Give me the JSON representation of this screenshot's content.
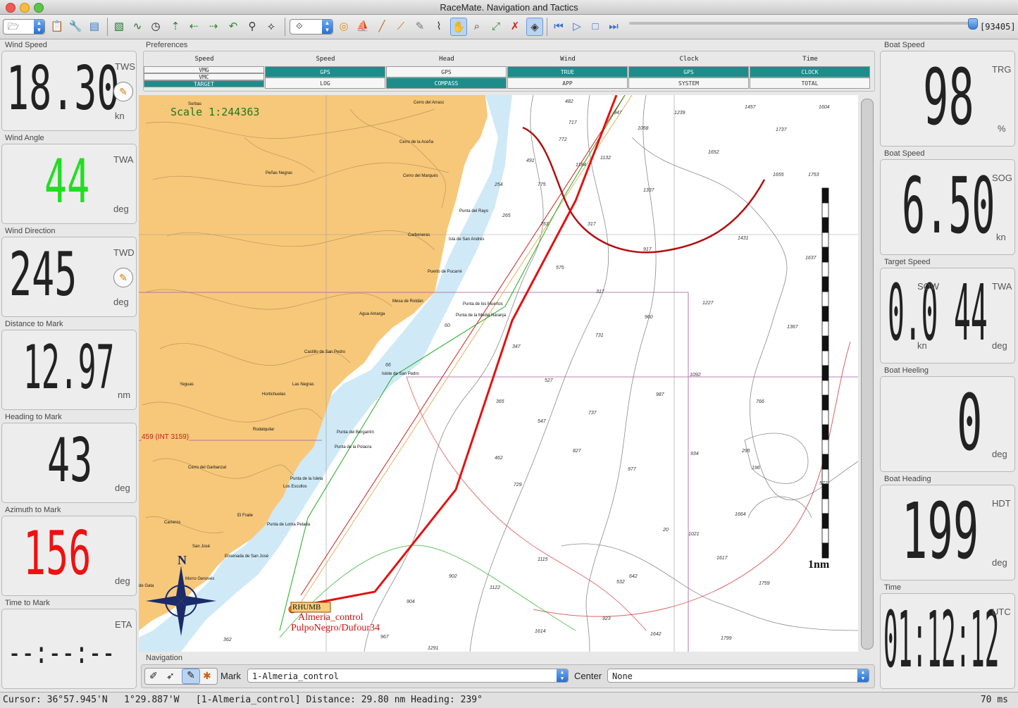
{
  "window": {
    "title": "RaceMate. Navigation and Tactics"
  },
  "toolbar": {
    "counter": "[93405]",
    "slider_position": 0.99,
    "icons": [
      "open-file-icon",
      "clipboard-icon",
      "wrench-icon",
      "database-icon",
      "chart-icon",
      "track-icon",
      "clock-icon",
      "waypoint-icon",
      "arrow-left-icon",
      "arrow-right-icon",
      "undo-icon",
      "route-icon",
      "route-edit-icon",
      "mode-select-icon",
      "target-icon",
      "boat-icon",
      "measure-icon",
      "ruler-icon",
      "pencil-icon",
      "draw-icon",
      "hand-icon",
      "zoom-icon",
      "fit-icon",
      "delete-icon",
      "layer-icon",
      "rewind-icon",
      "play-icon",
      "stop-icon",
      "fast-forward-icon"
    ]
  },
  "left": {
    "wind_speed": {
      "label": "Wind Speed",
      "value": "18.30",
      "tag": "TWS",
      "unit": "kn",
      "color": "#111111"
    },
    "wind_angle": {
      "label": "Wind Angle",
      "value": "44",
      "tag": "TWA",
      "unit": "deg",
      "color": "#22dd22"
    },
    "wind_dir": {
      "label": "Wind Direction",
      "value": "245",
      "tag": "TWD",
      "unit": "deg",
      "color": "#111111"
    },
    "dist_mark": {
      "label": "Distance to Mark",
      "value": "12.97",
      "unit": "nm",
      "color": "#111111"
    },
    "heading_mark": {
      "label": "Heading to Mark",
      "value": "43",
      "unit": "deg",
      "color": "#111111"
    },
    "azimuth_mark": {
      "label": "Azimuth to Mark",
      "value": "156",
      "unit": "deg",
      "color": "#ee1111"
    },
    "time_mark": {
      "label": "Time to Mark",
      "value": "--:--:--",
      "tag": "ETA",
      "color": "#111111"
    }
  },
  "right": {
    "boat_speed_trg": {
      "label": "Boat Speed",
      "value": "98",
      "tag": "TRG",
      "unit": "%"
    },
    "boat_speed_sog": {
      "label": "Boat Speed",
      "value": "6.50",
      "tag": "SOG",
      "unit": "kn"
    },
    "target_speed": {
      "label": "Target Speed",
      "sow_value": "0.0",
      "sow_tag": "SOW",
      "sow_unit": "kn",
      "twa_value": "44",
      "twa_tag": "TWA",
      "twa_unit": "deg"
    },
    "boat_heeling": {
      "label": "Boat Heeling",
      "value": "0",
      "unit": "deg"
    },
    "boat_heading": {
      "label": "Boat Heading",
      "value": "199",
      "tag": "HDT",
      "unit": "deg"
    },
    "time": {
      "label": "Time",
      "value": "01:12:12",
      "tag": "UTC"
    }
  },
  "preferences": {
    "label": "Preferences",
    "columns": [
      {
        "header": "Speed",
        "options": [
          {
            "text": "VMG",
            "on": false
          },
          {
            "text": "VMC",
            "on": false
          },
          {
            "text": "TARGET",
            "on": true
          }
        ]
      },
      {
        "header": "Speed",
        "options": [
          {
            "text": "GPS",
            "on": true
          },
          {
            "text": "LOG",
            "on": false
          }
        ]
      },
      {
        "header": "Head",
        "options": [
          {
            "text": "GPS",
            "on": false
          },
          {
            "text": "COMPASS",
            "on": true
          }
        ]
      },
      {
        "header": "Wind",
        "options": [
          {
            "text": "TRUE",
            "on": true
          },
          {
            "text": "APP",
            "on": false
          }
        ]
      },
      {
        "header": "Clock",
        "options": [
          {
            "text": "GPS",
            "on": true
          },
          {
            "text": "SYSTEM",
            "on": false
          }
        ]
      },
      {
        "header": "Time",
        "options": [
          {
            "text": "CLOCK",
            "on": true
          },
          {
            "text": "TOTAL",
            "on": false
          }
        ]
      }
    ]
  },
  "chart": {
    "scale": "Scale 1:244363",
    "scale_bar_label": "1nm",
    "mark_label": "Almeria_control",
    "boat_label": "PulpoNegro/Dufour34",
    "mark_tag": "RHUMB",
    "chart_ref": "459 (INT 3159)",
    "places": [
      {
        "t": "Sorbas"
      },
      {
        "t": "Cerro del Arrasc"
      },
      {
        "t": "Cerro de la Aceña"
      },
      {
        "t": "Cerro del Marqués"
      },
      {
        "t": "Peñas Negras"
      },
      {
        "t": "Punta del Rayo"
      },
      {
        "t": "Carboneras"
      },
      {
        "t": "Isla de San Andrés"
      },
      {
        "t": "Puerto de Pucarré"
      },
      {
        "t": "Mesa de Roldán"
      },
      {
        "t": "Agua Amarga"
      },
      {
        "t": "Punta de los Muertos"
      },
      {
        "t": "Punta de la Media Naranja"
      },
      {
        "t": "Castillo de San Pedro"
      },
      {
        "t": "Islote de San Pedro"
      },
      {
        "t": "Las Negras"
      },
      {
        "t": "Yeguas"
      },
      {
        "t": "Hortichuelas"
      },
      {
        "t": "Rodalquilar"
      },
      {
        "t": "Punta del Bergantín"
      },
      {
        "t": "Punta de la Polacra"
      },
      {
        "t": "Cerro del Garbanzal"
      },
      {
        "t": "Punta de la Isleta"
      },
      {
        "t": "Los Escullos"
      },
      {
        "t": "El Fraile"
      },
      {
        "t": "Punta de Loma Pelada"
      },
      {
        "t": "Carreros"
      },
      {
        "t": "San José"
      },
      {
        "t": "Ensenada de San José"
      },
      {
        "t": "Morro Genovés"
      },
      {
        "t": "de Gata"
      }
    ],
    "depths": [
      "482",
      "947",
      "1239",
      "1457",
      "1604",
      "717",
      "1058",
      "1737",
      "772",
      "1132",
      "1652",
      "491",
      "1184",
      "1655",
      "1753",
      "775",
      "1337",
      "254",
      "265",
      "753",
      "317",
      "1431",
      "917",
      "575",
      "1637",
      "317",
      "1227",
      "60",
      "960",
      "347",
      "731",
      "1367",
      "66",
      "527",
      "1092",
      "365",
      "737",
      "987",
      "766",
      "547",
      "827",
      "977",
      "934",
      "295",
      "196",
      "462",
      "729",
      "572",
      "1664",
      "1021",
      "20",
      "642",
      "1115",
      "1617",
      "902",
      "1122",
      "532",
      "1759",
      "904",
      "923",
      "1614",
      "1642",
      "1799",
      "967",
      "1291",
      "362"
    ]
  },
  "navigation": {
    "label": "Navigation",
    "mark_label": "Mark",
    "mark_value": "1-Almeria_control",
    "center_label": "Center",
    "center_value": "None"
  },
  "status": {
    "cursor": "Cursor: 36°57.945'N   1°29.887'W   [1-Almeria_control] Distance: 29.80 nm Heading: 239°",
    "latency": "70 ms"
  }
}
